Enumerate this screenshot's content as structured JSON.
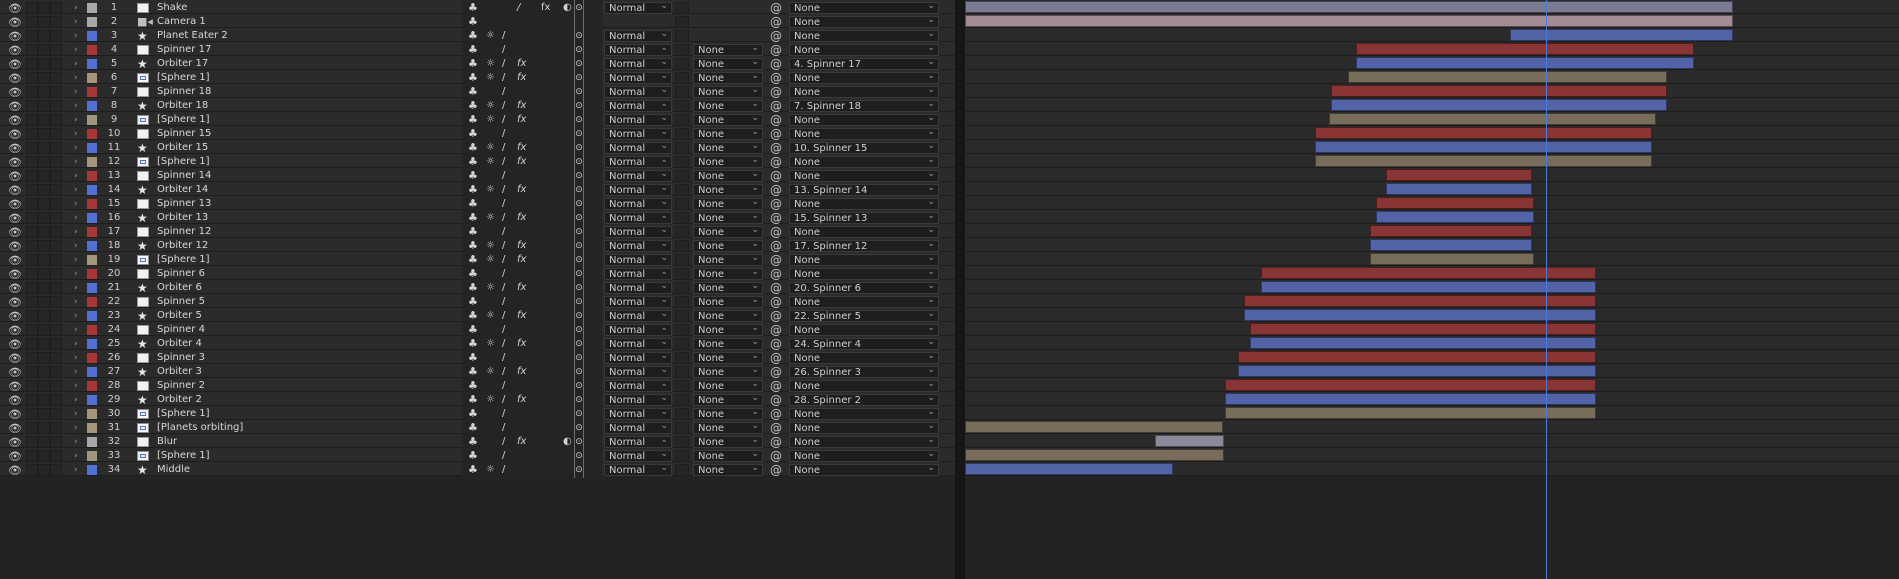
{
  "colors": {
    "label_gray": "#a8a8a8",
    "label_blue": "#5271d2",
    "label_red": "#a83636",
    "label_tan": "#a5957a",
    "bar_shake": "#7a7c94",
    "bar_camera": "#a38b96",
    "bar_red": "#8a3535",
    "bar_blue": "#5263a8",
    "bar_tan": "#776d5a",
    "bar_gray": "#8a8a98",
    "cti": "#4a7bd8"
  },
  "layers": [
    {
      "num": "1",
      "name": "Shake",
      "label": "gray",
      "icon": "solid",
      "sw": [
        "",
        "",
        "/",
        "fx"
      ],
      "adj": true,
      "mode": "Normal",
      "trkmat": "",
      "parent": "None",
      "bar": {
        "start": 0.0,
        "end": 1.0,
        "color": "shake"
      }
    },
    {
      "num": "2",
      "name": "Camera 1",
      "label": "gray",
      "icon": "camera",
      "sw": [
        "",
        "",
        "",
        ""
      ],
      "adj": false,
      "mode": "",
      "trkmat": "",
      "parent": "None",
      "bar": {
        "start": 0.0,
        "end": 1.0,
        "color": "camera"
      }
    },
    {
      "num": "3",
      "name": "Planet Eater 2",
      "label": "blue",
      "icon": "star",
      "sw": [
        "☼",
        "/",
        "",
        ""
      ],
      "adj": false,
      "mode": "Normal",
      "trkmat": "",
      "parent": "None",
      "bar": {
        "start": 0.709,
        "end": 1.0,
        "color": "blue"
      }
    },
    {
      "num": "4",
      "name": "Spinner 17",
      "label": "red",
      "icon": "solid",
      "sw": [
        "",
        "/",
        "",
        ""
      ],
      "adj": false,
      "mode": "Normal",
      "trkmat": "None",
      "parent": "None",
      "bar": {
        "start": 0.509,
        "end": 0.949,
        "color": "red"
      }
    },
    {
      "num": "5",
      "name": "Orbiter 17",
      "label": "blue",
      "icon": "star",
      "sw": [
        "☼",
        "/",
        "fx",
        ""
      ],
      "adj": false,
      "mode": "Normal",
      "trkmat": "None",
      "parent": "4. Spinner 17",
      "bar": {
        "start": 0.509,
        "end": 0.949,
        "color": "blue"
      }
    },
    {
      "num": "6",
      "name": "[Sphere 1]",
      "label": "tan",
      "icon": "comp",
      "sw": [
        "☼",
        "/",
        "fx",
        ""
      ],
      "adj": false,
      "mode": "Normal",
      "trkmat": "None",
      "parent": "None",
      "bar": {
        "start": 0.499,
        "end": 0.914,
        "color": "tan"
      }
    },
    {
      "num": "7",
      "name": "Spinner 18",
      "label": "red",
      "icon": "solid",
      "sw": [
        "",
        "/",
        "",
        ""
      ],
      "adj": false,
      "mode": "Normal",
      "trkmat": "None",
      "parent": "None",
      "bar": {
        "start": 0.477,
        "end": 0.914,
        "color": "red"
      }
    },
    {
      "num": "8",
      "name": "Orbiter 18",
      "label": "blue",
      "icon": "star",
      "sw": [
        "☼",
        "/",
        "fx",
        ""
      ],
      "adj": false,
      "mode": "Normal",
      "trkmat": "None",
      "parent": "7. Spinner 18",
      "bar": {
        "start": 0.477,
        "end": 0.914,
        "color": "blue"
      }
    },
    {
      "num": "9",
      "name": "[Sphere 1]",
      "label": "tan",
      "icon": "comp",
      "sw": [
        "☼",
        "/",
        "fx",
        ""
      ],
      "adj": false,
      "mode": "Normal",
      "trkmat": "None",
      "parent": "None",
      "bar": {
        "start": 0.474,
        "end": 0.9,
        "color": "tan"
      }
    },
    {
      "num": "10",
      "name": "Spinner 15",
      "label": "red",
      "icon": "solid",
      "sw": [
        "",
        "/",
        "",
        ""
      ],
      "adj": false,
      "mode": "Normal",
      "trkmat": "None",
      "parent": "None",
      "bar": {
        "start": 0.456,
        "end": 0.894,
        "color": "red"
      }
    },
    {
      "num": "11",
      "name": "Orbiter 15",
      "label": "blue",
      "icon": "star",
      "sw": [
        "☼",
        "/",
        "fx",
        ""
      ],
      "adj": false,
      "mode": "Normal",
      "trkmat": "None",
      "parent": "10. Spinner 15",
      "bar": {
        "start": 0.456,
        "end": 0.894,
        "color": "blue"
      }
    },
    {
      "num": "12",
      "name": "[Sphere 1]",
      "label": "tan",
      "icon": "comp",
      "sw": [
        "☼",
        "/",
        "fx",
        ""
      ],
      "adj": false,
      "mode": "Normal",
      "trkmat": "None",
      "parent": "None",
      "bar": {
        "start": 0.456,
        "end": 0.894,
        "color": "tan"
      }
    },
    {
      "num": "13",
      "name": "Spinner 14",
      "label": "red",
      "icon": "solid",
      "sw": [
        "",
        "/",
        "",
        ""
      ],
      "adj": false,
      "mode": "Normal",
      "trkmat": "None",
      "parent": "None",
      "bar": {
        "start": 0.548,
        "end": 0.738,
        "color": "red"
      }
    },
    {
      "num": "14",
      "name": "Orbiter 14",
      "label": "blue",
      "icon": "star",
      "sw": [
        "☼",
        "/",
        "fx",
        ""
      ],
      "adj": false,
      "mode": "Normal",
      "trkmat": "None",
      "parent": "13. Spinner 14",
      "bar": {
        "start": 0.548,
        "end": 0.738,
        "color": "blue"
      }
    },
    {
      "num": "15",
      "name": "Spinner 13",
      "label": "red",
      "icon": "solid",
      "sw": [
        "",
        "/",
        "",
        ""
      ],
      "adj": false,
      "mode": "Normal",
      "trkmat": "None",
      "parent": "None",
      "bar": {
        "start": 0.535,
        "end": 0.741,
        "color": "red"
      }
    },
    {
      "num": "16",
      "name": "Orbiter 13",
      "label": "blue",
      "icon": "star",
      "sw": [
        "☼",
        "/",
        "fx",
        ""
      ],
      "adj": false,
      "mode": "Normal",
      "trkmat": "None",
      "parent": "15. Spinner 13",
      "bar": {
        "start": 0.535,
        "end": 0.741,
        "color": "blue"
      }
    },
    {
      "num": "17",
      "name": "Spinner 12",
      "label": "red",
      "icon": "solid",
      "sw": [
        "",
        "/",
        "",
        ""
      ],
      "adj": false,
      "mode": "Normal",
      "trkmat": "None",
      "parent": "None",
      "bar": {
        "start": 0.527,
        "end": 0.738,
        "color": "red"
      }
    },
    {
      "num": "18",
      "name": "Orbiter 12",
      "label": "blue",
      "icon": "star",
      "sw": [
        "☼",
        "/",
        "fx",
        ""
      ],
      "adj": false,
      "mode": "Normal",
      "trkmat": "None",
      "parent": "17. Spinner 12",
      "bar": {
        "start": 0.527,
        "end": 0.738,
        "color": "blue"
      }
    },
    {
      "num": "19",
      "name": "[Sphere 1]",
      "label": "tan",
      "icon": "comp",
      "sw": [
        "☼",
        "/",
        "fx",
        ""
      ],
      "adj": false,
      "mode": "Normal",
      "trkmat": "None",
      "parent": "None",
      "bar": {
        "start": 0.527,
        "end": 0.741,
        "color": "tan"
      }
    },
    {
      "num": "20",
      "name": "Spinner 6",
      "label": "red",
      "icon": "solid",
      "sw": [
        "",
        "/",
        "",
        ""
      ],
      "adj": false,
      "mode": "Normal",
      "trkmat": "None",
      "parent": "None",
      "bar": {
        "start": 0.386,
        "end": 0.822,
        "color": "red"
      }
    },
    {
      "num": "21",
      "name": "Orbiter 6",
      "label": "blue",
      "icon": "star",
      "sw": [
        "☼",
        "/",
        "fx",
        ""
      ],
      "adj": false,
      "mode": "Normal",
      "trkmat": "None",
      "parent": "20. Spinner 6",
      "bar": {
        "start": 0.386,
        "end": 0.822,
        "color": "blue"
      }
    },
    {
      "num": "22",
      "name": "Spinner 5",
      "label": "red",
      "icon": "solid",
      "sw": [
        "",
        "/",
        "",
        ""
      ],
      "adj": false,
      "mode": "Normal",
      "trkmat": "None",
      "parent": "None",
      "bar": {
        "start": 0.363,
        "end": 0.822,
        "color": "red"
      }
    },
    {
      "num": "23",
      "name": "Orbiter 5",
      "label": "blue",
      "icon": "star",
      "sw": [
        "☼",
        "/",
        "fx",
        ""
      ],
      "adj": false,
      "mode": "Normal",
      "trkmat": "None",
      "parent": "22. Spinner 5",
      "bar": {
        "start": 0.363,
        "end": 0.822,
        "color": "blue"
      }
    },
    {
      "num": "24",
      "name": "Spinner 4",
      "label": "red",
      "icon": "solid",
      "sw": [
        "",
        "/",
        "",
        ""
      ],
      "adj": false,
      "mode": "Normal",
      "trkmat": "None",
      "parent": "None",
      "bar": {
        "start": 0.371,
        "end": 0.822,
        "color": "red"
      }
    },
    {
      "num": "25",
      "name": "Orbiter 4",
      "label": "blue",
      "icon": "star",
      "sw": [
        "☼",
        "/",
        "fx",
        ""
      ],
      "adj": false,
      "mode": "Normal",
      "trkmat": "None",
      "parent": "24. Spinner 4",
      "bar": {
        "start": 0.371,
        "end": 0.822,
        "color": "blue"
      }
    },
    {
      "num": "26",
      "name": "Spinner 3",
      "label": "red",
      "icon": "solid",
      "sw": [
        "",
        "/",
        "",
        ""
      ],
      "adj": false,
      "mode": "Normal",
      "trkmat": "None",
      "parent": "None",
      "bar": {
        "start": 0.355,
        "end": 0.822,
        "color": "red"
      }
    },
    {
      "num": "27",
      "name": "Orbiter 3",
      "label": "blue",
      "icon": "star",
      "sw": [
        "☼",
        "/",
        "fx",
        ""
      ],
      "adj": false,
      "mode": "Normal",
      "trkmat": "None",
      "parent": "26. Spinner 3",
      "bar": {
        "start": 0.355,
        "end": 0.822,
        "color": "blue"
      }
    },
    {
      "num": "28",
      "name": "Spinner 2",
      "label": "red",
      "icon": "solid",
      "sw": [
        "",
        "/",
        "",
        ""
      ],
      "adj": false,
      "mode": "Normal",
      "trkmat": "None",
      "parent": "None",
      "bar": {
        "start": 0.339,
        "end": 0.822,
        "color": "red"
      }
    },
    {
      "num": "29",
      "name": "Orbiter 2",
      "label": "blue",
      "icon": "star",
      "sw": [
        "☼",
        "/",
        "fx",
        ""
      ],
      "adj": false,
      "mode": "Normal",
      "trkmat": "None",
      "parent": "28. Spinner 2",
      "bar": {
        "start": 0.339,
        "end": 0.822,
        "color": "blue"
      }
    },
    {
      "num": "30",
      "name": "[Sphere 1]",
      "label": "tan",
      "icon": "comp",
      "sw": [
        "",
        "/",
        "",
        ""
      ],
      "adj": false,
      "mode": "Normal",
      "trkmat": "None",
      "parent": "None",
      "bar": {
        "start": 0.339,
        "end": 0.822,
        "color": "tan"
      }
    },
    {
      "num": "31",
      "name": "[Planets orbiting]",
      "label": "tan",
      "icon": "comp",
      "sw": [
        "",
        "/",
        "",
        ""
      ],
      "adj": false,
      "mode": "Normal",
      "trkmat": "None",
      "parent": "None",
      "bar": {
        "start": 0.0,
        "end": 0.336,
        "color": "tan"
      }
    },
    {
      "num": "32",
      "name": "Blur",
      "label": "gray",
      "icon": "solid",
      "sw": [
        "",
        "/",
        "fx",
        ""
      ],
      "adj": true,
      "mode": "Normal",
      "trkmat": "None",
      "parent": "None",
      "bar": {
        "start": 0.248,
        "end": 0.337,
        "color": "gray"
      }
    },
    {
      "num": "33",
      "name": "[Sphere 1]",
      "label": "tan",
      "icon": "comp",
      "sw": [
        "",
        "/",
        "",
        ""
      ],
      "adj": false,
      "mode": "Normal",
      "trkmat": "None",
      "parent": "None",
      "bar": {
        "start": 0.0,
        "end": 0.337,
        "color": "tan"
      }
    },
    {
      "num": "34",
      "name": "Middle",
      "label": "blue",
      "icon": "star",
      "sw": [
        "☼",
        "/",
        "",
        ""
      ],
      "adj": false,
      "mode": "Normal",
      "trkmat": "None",
      "parent": "None",
      "bar": {
        "start": 0.0,
        "end": 0.271,
        "color": "blue"
      }
    }
  ],
  "timeline": {
    "current_time_fraction": 0.756
  }
}
